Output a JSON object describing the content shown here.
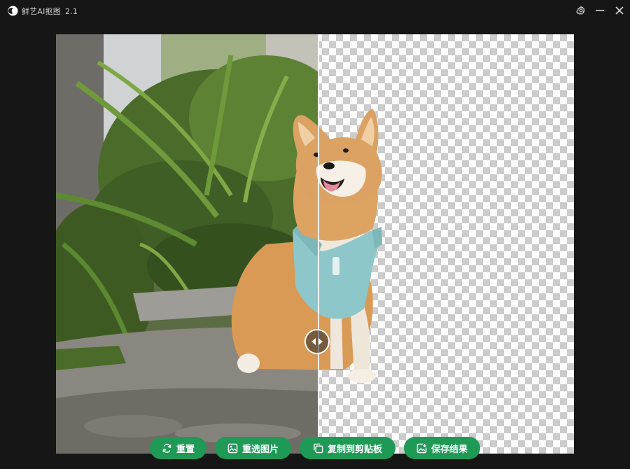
{
  "app": {
    "title": "鲜艺AI抠图",
    "version": "2.1"
  },
  "titlebar": {
    "settings_icon": "gear-icon",
    "minimize_icon": "minimize-icon",
    "close_icon": "close-icon"
  },
  "compare": {
    "split_position": 0.507,
    "left_view": "original photo",
    "right_view": "background removed (transparent)"
  },
  "actions": {
    "reset": {
      "label": "重置",
      "icon": "refresh-icon"
    },
    "reselect": {
      "label": "重选图片",
      "icon": "image-icon"
    },
    "copy": {
      "label": "复制到剪贴板",
      "icon": "copy-icon"
    },
    "save": {
      "label": "保存结果",
      "icon": "image-save-icon"
    }
  },
  "colors": {
    "background": "#161616",
    "accent": "#1f9a56",
    "divider": "#ffffff"
  }
}
